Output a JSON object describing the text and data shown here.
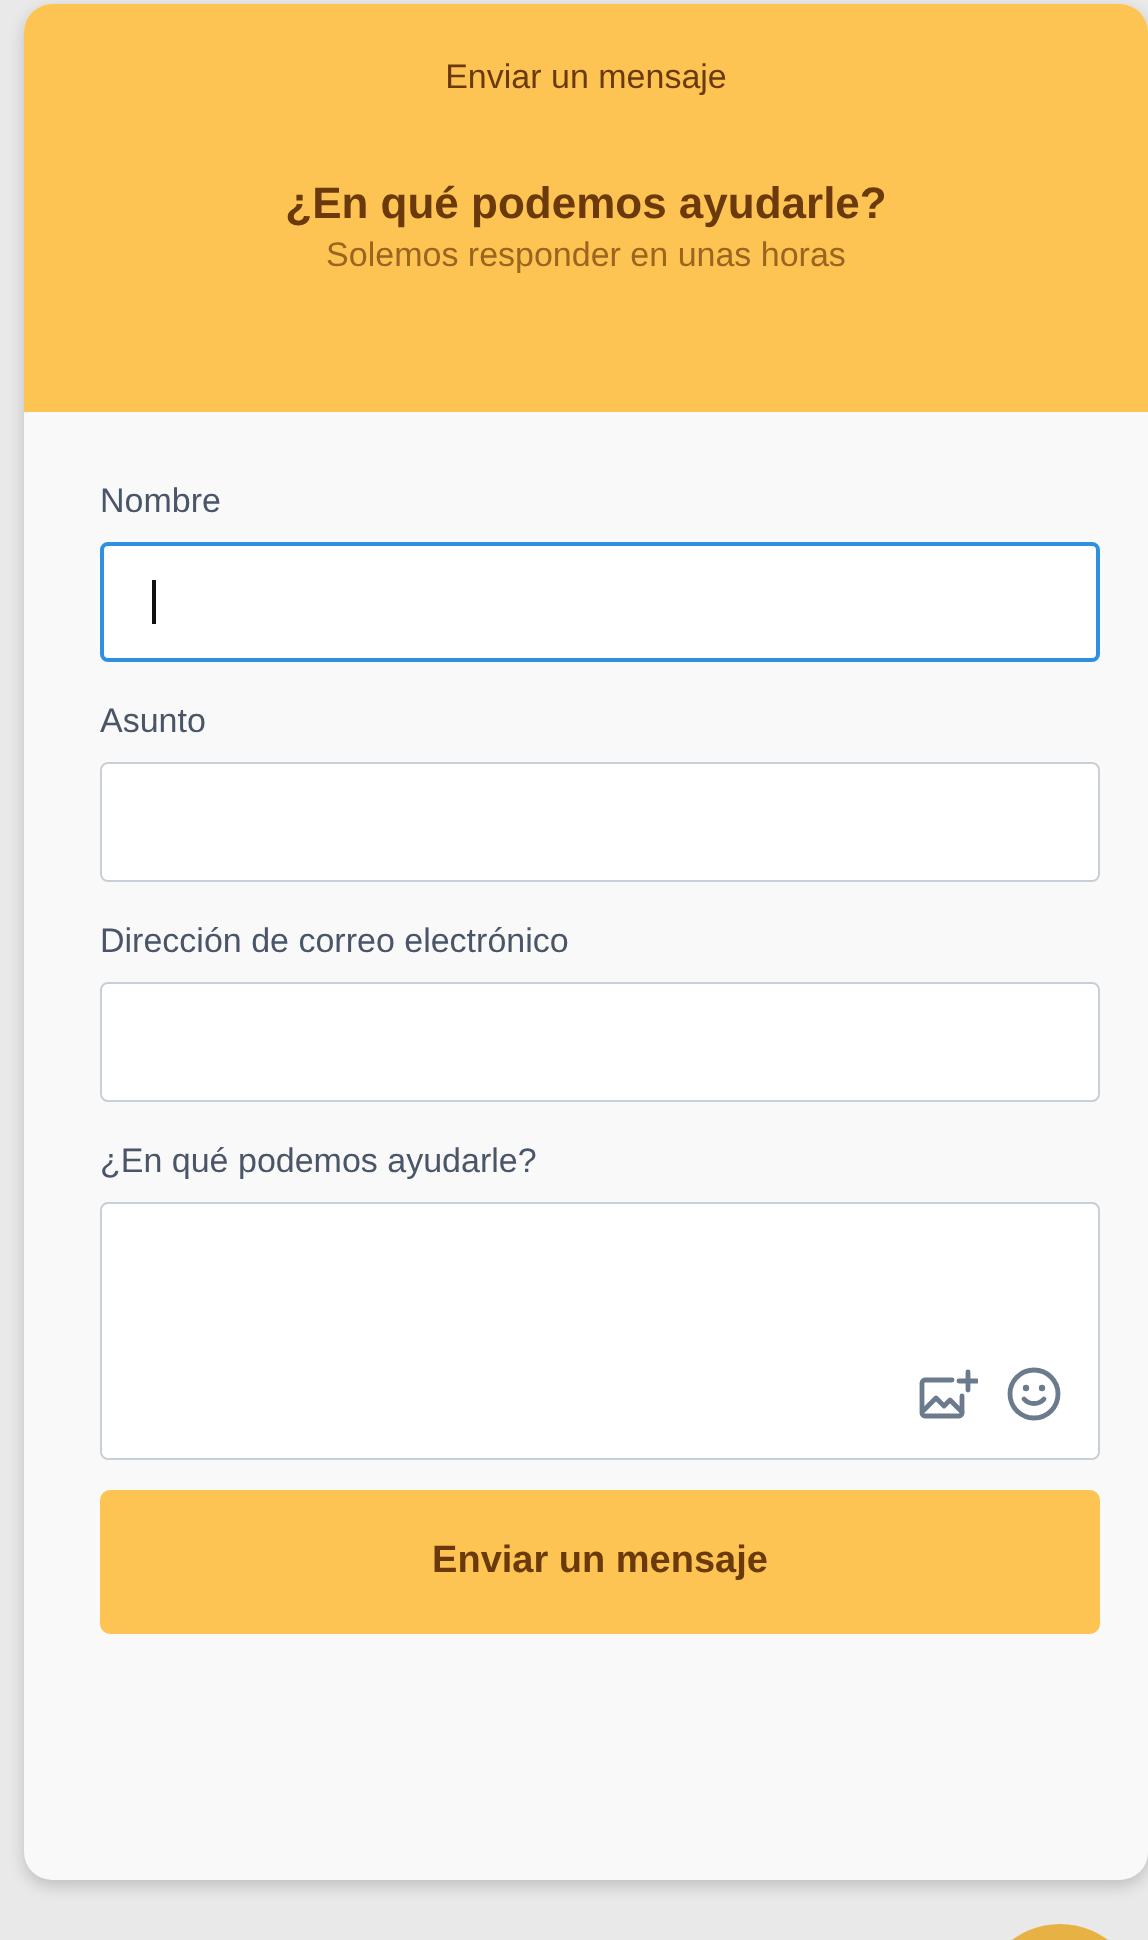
{
  "header": {
    "title": "Enviar un mensaje",
    "heading": "¿En qué podemos ayudarle?",
    "subheading": "Solemos responder en unas horas"
  },
  "fields": [
    {
      "kind": "text",
      "label": "Nombre",
      "focused": true
    },
    {
      "kind": "text",
      "label": "Asunto",
      "focused": false
    },
    {
      "kind": "text",
      "label": "Dirección de correo electrónico",
      "focused": false
    },
    {
      "kind": "textarea",
      "label": "¿En qué podemos ayudarle?",
      "focused": false
    }
  ],
  "submit": "Enviar un mensaje"
}
